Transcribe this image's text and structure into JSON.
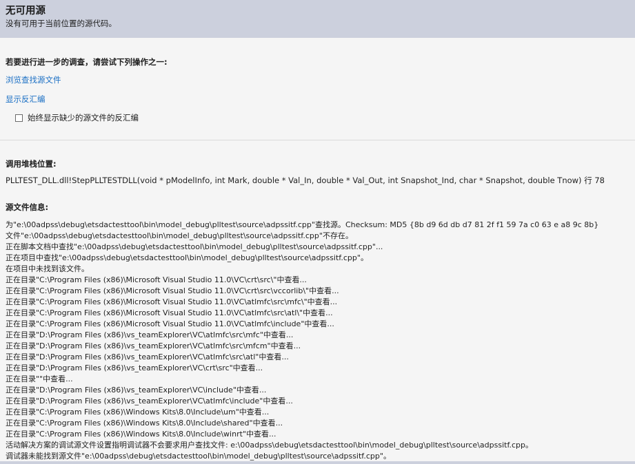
{
  "header": {
    "title": "无可用源",
    "subtitle": "没有可用于当前位置的源代码。"
  },
  "actions": {
    "heading": "若要进行进一步的调查，请尝试下列操作之一:",
    "browse_link": "浏览查找源文件",
    "disassembly_link": "显示反汇编",
    "checkbox_label": "始终显示缺少的源文件的反汇编",
    "checkbox_checked": false
  },
  "callstack": {
    "heading": "调用堆栈位置:",
    "location": "PLLTEST_DLL.dll!StepPLLTESTDLL(void * pModelInfo, int Mark, double * Val_In, double * Val_Out, int Snapshot_Ind, char * Snapshot, double Tnow) 行 78"
  },
  "source_info": {
    "heading": "源文件信息:",
    "lines": [
      "为\"e:\\00adpss\\debug\\etsdactesttool\\bin\\model_debug\\plltest\\source\\adpssitf.cpp\"查找源。Checksum: MD5 {8b d9 6d db d7 81 2f f1 59 7a c0 63 e a8 9c 8b}",
      "文件\"e:\\00adpss\\debug\\etsdactesttool\\bin\\model_debug\\plltest\\source\\adpssitf.cpp\"不存在。",
      "正在脚本文档中查找\"e:\\00adpss\\debug\\etsdactesttool\\bin\\model_debug\\plltest\\source\\adpssitf.cpp\"...",
      "正在项目中查找\"e:\\00adpss\\debug\\etsdactesttool\\bin\\model_debug\\plltest\\source\\adpssitf.cpp\"。",
      "在项目中未找到该文件。",
      "正在目录\"C:\\Program Files (x86)\\Microsoft Visual Studio 11.0\\VC\\crt\\src\\\"中查看...",
      "正在目录\"C:\\Program Files (x86)\\Microsoft Visual Studio 11.0\\VC\\crt\\src\\vccorlib\\\"中查看...",
      "正在目录\"C:\\Program Files (x86)\\Microsoft Visual Studio 11.0\\VC\\atlmfc\\src\\mfc\\\"中查看...",
      "正在目录\"C:\\Program Files (x86)\\Microsoft Visual Studio 11.0\\VC\\atlmfc\\src\\atl\\\"中查看...",
      "正在目录\"C:\\Program Files (x86)\\Microsoft Visual Studio 11.0\\VC\\atlmfc\\include\"中查看...",
      "正在目录\"D:\\Program Files (x86)\\vs_teamExplorer\\VC\\atlmfc\\src\\mfc\"中查看...",
      "正在目录\"D:\\Program Files (x86)\\vs_teamExplorer\\VC\\atlmfc\\src\\mfcm\"中查看...",
      "正在目录\"D:\\Program Files (x86)\\vs_teamExplorer\\VC\\atlmfc\\src\\atl\"中查看...",
      "正在目录\"D:\\Program Files (x86)\\vs_teamExplorer\\VC\\crt\\src\"中查看...",
      "正在目录\"\"中查看...",
      "正在目录\"D:\\Program Files (x86)\\vs_teamExplorer\\VC\\include\"中查看...",
      "正在目录\"D:\\Program Files (x86)\\vs_teamExplorer\\VC\\atlmfc\\include\"中查看...",
      "正在目录\"C:\\Program Files (x86)\\Windows Kits\\8.0\\Include\\um\"中查看...",
      "正在目录\"C:\\Program Files (x86)\\Windows Kits\\8.0\\Include\\shared\"中查看...",
      "正在目录\"C:\\Program Files (x86)\\Windows Kits\\8.0\\Include\\winrt\"中查看...",
      "活动解决方案的调试源文件设置指明调试器不会要求用户查找文件: e:\\00adpss\\debug\\etsdactesttool\\bin\\model_debug\\plltest\\source\\adpssitf.cpp。",
      "调试器未能找到源文件\"e:\\00adpss\\debug\\etsdactesttool\\bin\\model_debug\\plltest\\source\\adpssitf.cpp\"。"
    ]
  },
  "colors": {
    "header_bg": "#ccd0dd",
    "page_bg": "#f5f5f5",
    "link": "#1a6fc4"
  }
}
